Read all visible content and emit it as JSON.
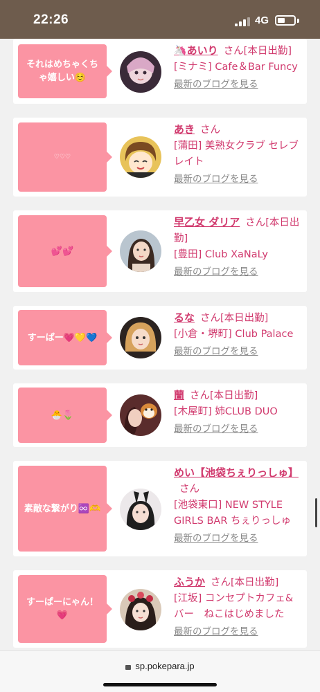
{
  "status": {
    "time": "22:26",
    "network": "4G"
  },
  "browser": {
    "url": "sp.pokepara.jp"
  },
  "colors": {
    "bubble": "#fb94a3",
    "accent": "#d13a6e",
    "statusbar": "#6e5c4d"
  },
  "posts": [
    {
      "message": "それはめちゃくちゃ嬉しい☺️",
      "name": "🦄あいり",
      "suffix": "さん[本日出勤]",
      "shop": "[ミナミ] Cafe＆Bar Funcy",
      "blog": "最新のブログを見る"
    },
    {
      "message": "♡♡♡",
      "name": "あき",
      "suffix": "さん",
      "shop": "[蒲田] 美熟女クラブ セレブレイト",
      "blog": "最新のブログを見る"
    },
    {
      "message": "💕💕",
      "name": "早乙女 ダリア",
      "suffix": "さん[本日出勤]",
      "shop": "[豊田] Club XaNaLy",
      "blog": "最新のブログを見る"
    },
    {
      "message": "すーぱー💗💛💙",
      "name": "るな",
      "suffix": "さん[本日出勤]",
      "shop": "[小倉・堺町] Club Palace",
      "blog": "最新のブログを見る"
    },
    {
      "message": "🐣🌷",
      "name": "蘭",
      "suffix": "さん[本日出勤]",
      "shop": "[木屋町] 姉CLUB DUO",
      "blog": "最新のブログを見る"
    },
    {
      "message": "素敵な繋がり♾️🫶",
      "name": "めい【池袋ちぇりっしゅ】",
      "suffix": "さん",
      "shop": "[池袋東口] NEW STYLE GIRLS BAR ちぇりっしゅ",
      "blog": "最新のブログを見る"
    },
    {
      "message": "すーぱーにゃん！💗",
      "name": "ふうか",
      "suffix": "さん[本日出勤]",
      "shop": "[江坂] コンセプトカフェ&バー　ねこはじめました",
      "blog": "最新のブログを見る"
    }
  ]
}
